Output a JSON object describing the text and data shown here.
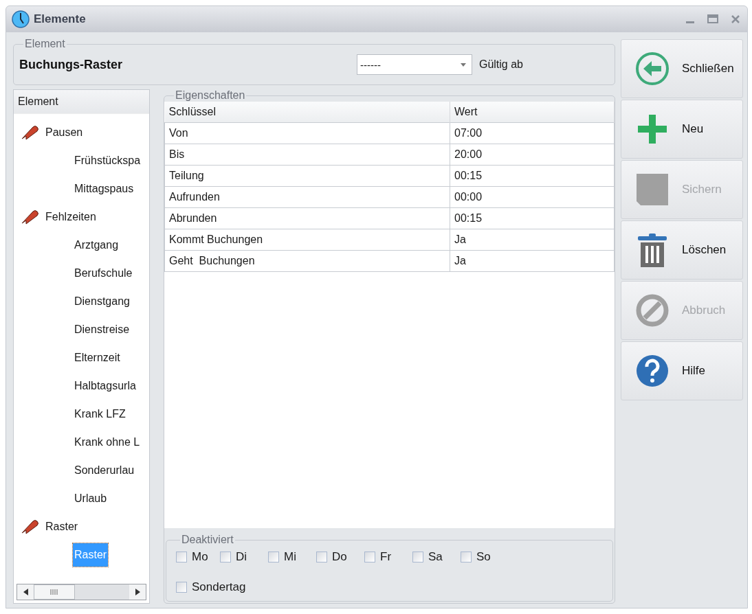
{
  "window": {
    "title": "Elemente"
  },
  "element_group": {
    "legend": "Element",
    "name": "Buchungs-Raster",
    "combo_value": "------",
    "valid_label": "Gültig ab"
  },
  "tree": {
    "header": "Element",
    "items": [
      {
        "label": "Pausen",
        "children": [
          {
            "label": "Frühstückspa",
            "selected": false
          },
          {
            "label": "Mittagspaus",
            "selected": false
          }
        ]
      },
      {
        "label": "Fehlzeiten",
        "children": [
          {
            "label": "Arztgang",
            "selected": false
          },
          {
            "label": "Berufschule",
            "selected": false
          },
          {
            "label": "Dienstgang",
            "selected": false
          },
          {
            "label": "Dienstreise",
            "selected": false
          },
          {
            "label": "Elternzeit",
            "selected": false
          },
          {
            "label": "Halbtagsurla",
            "selected": false
          },
          {
            "label": "Krank LFZ",
            "selected": false
          },
          {
            "label": "Krank ohne L",
            "selected": false
          },
          {
            "label": "Sonderurlau",
            "selected": false
          },
          {
            "label": "Urlaub",
            "selected": false
          }
        ]
      },
      {
        "label": "Raster",
        "children": [
          {
            "label": "Raster",
            "selected": true
          }
        ]
      }
    ]
  },
  "properties": {
    "legend": "Eigenschaften",
    "columns": [
      "Schlüssel",
      "Wert"
    ],
    "rows": [
      {
        "key": "Von",
        "value": "07:00"
      },
      {
        "key": "Bis",
        "value": "20:00"
      },
      {
        "key": "Teilung",
        "value": "00:15"
      },
      {
        "key": "Aufrunden",
        "value": "00:00"
      },
      {
        "key": "Abrunden",
        "value": "00:15"
      },
      {
        "key": "Kommt Buchungen",
        "value": "Ja"
      },
      {
        "key": "Geht  Buchungen",
        "value": "Ja"
      }
    ]
  },
  "deactivated": {
    "legend": "Deaktiviert",
    "days": [
      {
        "label": "Mo",
        "checked": false
      },
      {
        "label": "Di",
        "checked": false
      },
      {
        "label": "Mi",
        "checked": false
      },
      {
        "label": "Do",
        "checked": false
      },
      {
        "label": "Fr",
        "checked": false
      },
      {
        "label": "Sa",
        "checked": false
      },
      {
        "label": "So",
        "checked": false
      }
    ],
    "special": {
      "label": "Sondertag",
      "checked": false
    }
  },
  "actions": [
    {
      "kind": "back",
      "label": "Schließen",
      "disabled": false
    },
    {
      "kind": "add",
      "label": "Neu",
      "disabled": false
    },
    {
      "kind": "save",
      "label": "Sichern",
      "disabled": true
    },
    {
      "kind": "delete",
      "label": "Löschen",
      "disabled": false
    },
    {
      "kind": "cancel",
      "label": "Abbruch",
      "disabled": true
    },
    {
      "kind": "help",
      "label": "Hilfe",
      "disabled": false
    }
  ]
}
